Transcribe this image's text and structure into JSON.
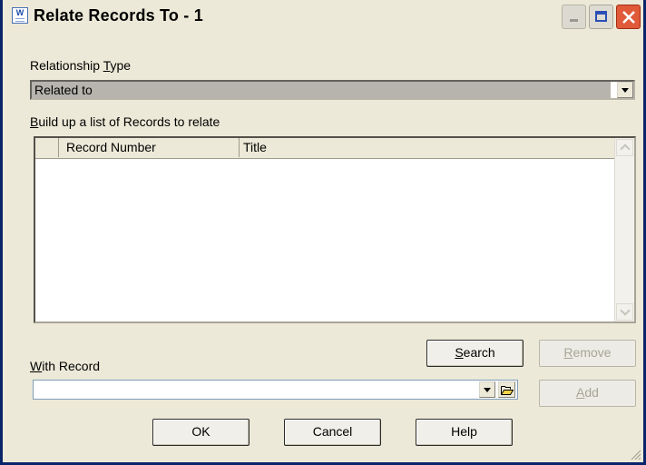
{
  "window": {
    "title": "Relate Records To - 1",
    "app_icon": "word-document-icon",
    "app_icon_letter": "W"
  },
  "relationship_type": {
    "label_pre": "Relationship ",
    "label_accel": "T",
    "label_post": "ype",
    "selected": "Related to"
  },
  "records_list": {
    "label_accel": "B",
    "label_post": "uild up a list of Records to relate",
    "columns": [
      "",
      "Record Number",
      "Title"
    ],
    "rows": []
  },
  "with_record": {
    "label_accel": "W",
    "label_post": "ith Record",
    "value": ""
  },
  "buttons": {
    "search_accel": "S",
    "search_post": "earch",
    "remove_accel": "R",
    "remove_post": "emove",
    "add_accel": "A",
    "add_post": "dd",
    "ok": "OK",
    "cancel": "Cancel",
    "help": "Help"
  },
  "colors": {
    "window_bg": "#ece9d8",
    "frame": "#0a246a",
    "close_button": "#e05a3a",
    "selected_value_bg": "#b6b4ad"
  }
}
